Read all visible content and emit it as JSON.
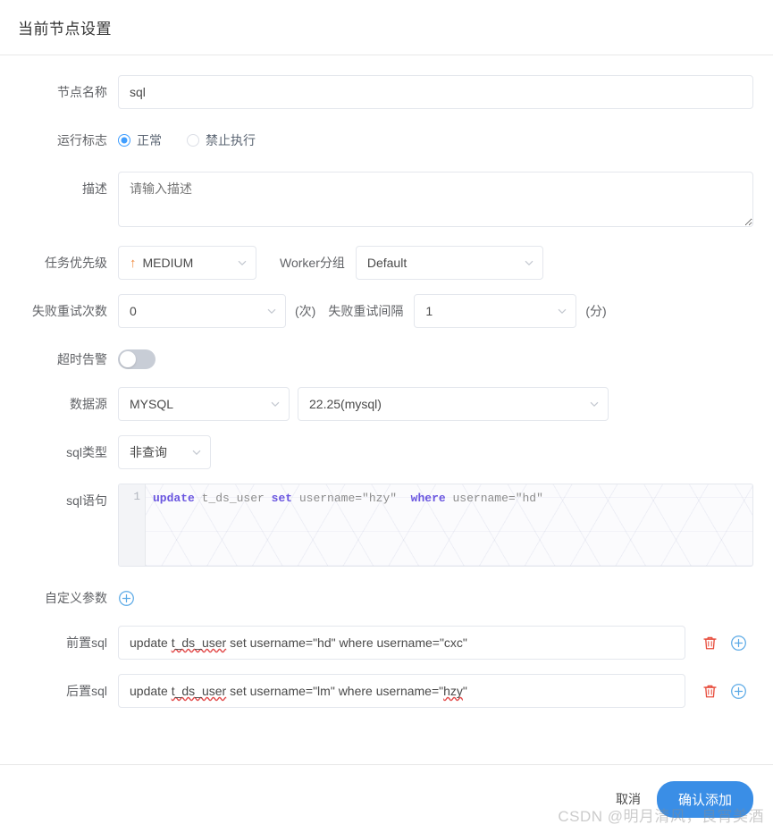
{
  "header": {
    "title": "当前节点设置"
  },
  "form": {
    "node_name": {
      "label": "节点名称",
      "value": "sql"
    },
    "run_flag": {
      "label": "运行标志",
      "options": [
        {
          "label": "正常",
          "checked": true
        },
        {
          "label": "禁止执行",
          "checked": false
        }
      ]
    },
    "description": {
      "label": "描述",
      "value": "",
      "placeholder": "请输入描述"
    },
    "priority": {
      "label": "任务优先级",
      "value": "MEDIUM",
      "arrow": "↑",
      "arrow_color": "#f0883a"
    },
    "worker_group": {
      "label": "Worker分组",
      "value": "Default"
    },
    "retry_times": {
      "label": "失败重试次数",
      "value": "0",
      "unit": "(次)"
    },
    "retry_interval": {
      "label": "失败重试间隔",
      "value": "1",
      "unit": "(分)"
    },
    "timeout_alarm": {
      "label": "超时告警",
      "enabled": false
    },
    "datasource": {
      "label": "数据源",
      "type_value": "MYSQL",
      "instance_value": "22.25(mysql)"
    },
    "sql_type": {
      "label": "sql类型",
      "value": "非查询"
    },
    "sql_statement": {
      "label": "sql语句",
      "line_number": "1",
      "tokens": [
        {
          "t": "update",
          "c": "kw"
        },
        {
          "t": " t_ds_user ",
          "c": "pl"
        },
        {
          "t": "set",
          "c": "kw"
        },
        {
          "t": " username=\"hzy\"  ",
          "c": "pl"
        },
        {
          "t": "where",
          "c": "kw"
        },
        {
          "t": " username=\"hd\"",
          "c": "pl"
        }
      ],
      "plain_text": "update t_ds_user set username=\"hzy\"  where username=\"hd\""
    },
    "custom_params": {
      "label": "自定义参数",
      "add_icon": "plus-circle-icon"
    },
    "pre_sql": {
      "label": "前置sql",
      "value": "update t_ds_user set username=\"hd\"  where username=\"cxc\"",
      "delete_icon": "trash-icon",
      "add_icon": "plus-circle-icon"
    },
    "post_sql": {
      "label": "后置sql",
      "value": "update t_ds_user set username=\"lm\"  where username=\"hzy\"",
      "delete_icon": "trash-icon",
      "add_icon": "plus-circle-icon"
    }
  },
  "footer": {
    "cancel_label": "取消",
    "confirm_label": "确认添加"
  },
  "watermark": {
    "text": "CSDN @明月清风，良宵美酒"
  },
  "colors": {
    "primary": "#3a8ee6",
    "radio_active": "#409eff",
    "danger": "#e74c3c",
    "priority_arrow": "#f0883a",
    "keyword": "#6a56e0"
  }
}
